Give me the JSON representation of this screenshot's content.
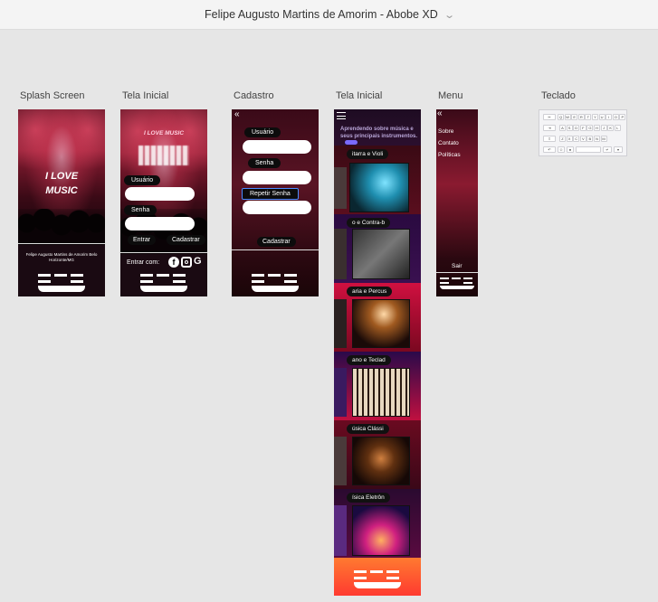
{
  "window": {
    "title": "Felipe Augusto Martins de Amorim - Abobe XD"
  },
  "artboards": {
    "splash": {
      "label": "Splash Screen",
      "title_line1": "I LOVE",
      "title_line2": "MUSIC",
      "footer_text": "Felipe Augusto Martins de Amorim Belo Horizonte/MG"
    },
    "home": {
      "label": "Tela Inicial",
      "title": "I LOVE MUSIC",
      "user_label": "Usuário",
      "pass_label": "Senha",
      "enter": "Entrar",
      "register": "Cadastrar",
      "enter_with": "Entrar com:"
    },
    "signup": {
      "label": "Cadastro",
      "user_label": "Usuário",
      "pass_label": "Senha",
      "repeat_label": "Repetir Senha",
      "register": "Cadastrar"
    },
    "home2": {
      "label": "Tela Inicial",
      "subtitle": "Aprendendo sobre música e seus principais instrumentos.",
      "categories": [
        {
          "label": "itarra e Violi"
        },
        {
          "label": "o e Contra-b"
        },
        {
          "label": "aria e Percus"
        },
        {
          "label": "ano e Teclad"
        },
        {
          "label": "úsica Clássi"
        },
        {
          "label": "ísica Eletrôn"
        }
      ]
    },
    "menu": {
      "label": "Menu",
      "items": [
        "Sobre",
        "Contato",
        "Políticas"
      ],
      "exit": "Sair"
    },
    "keyboard": {
      "label": "Teclado",
      "row1": [
        "Q",
        "W",
        "E",
        "R",
        "T",
        "Y",
        "U",
        "I",
        "O",
        "P"
      ],
      "row2": [
        "A",
        "S",
        "D",
        "F",
        "G",
        "H",
        "J",
        "K",
        "L"
      ],
      "row3": [
        "Z",
        "X",
        "C",
        "V",
        "B",
        "N",
        "M"
      ]
    }
  }
}
